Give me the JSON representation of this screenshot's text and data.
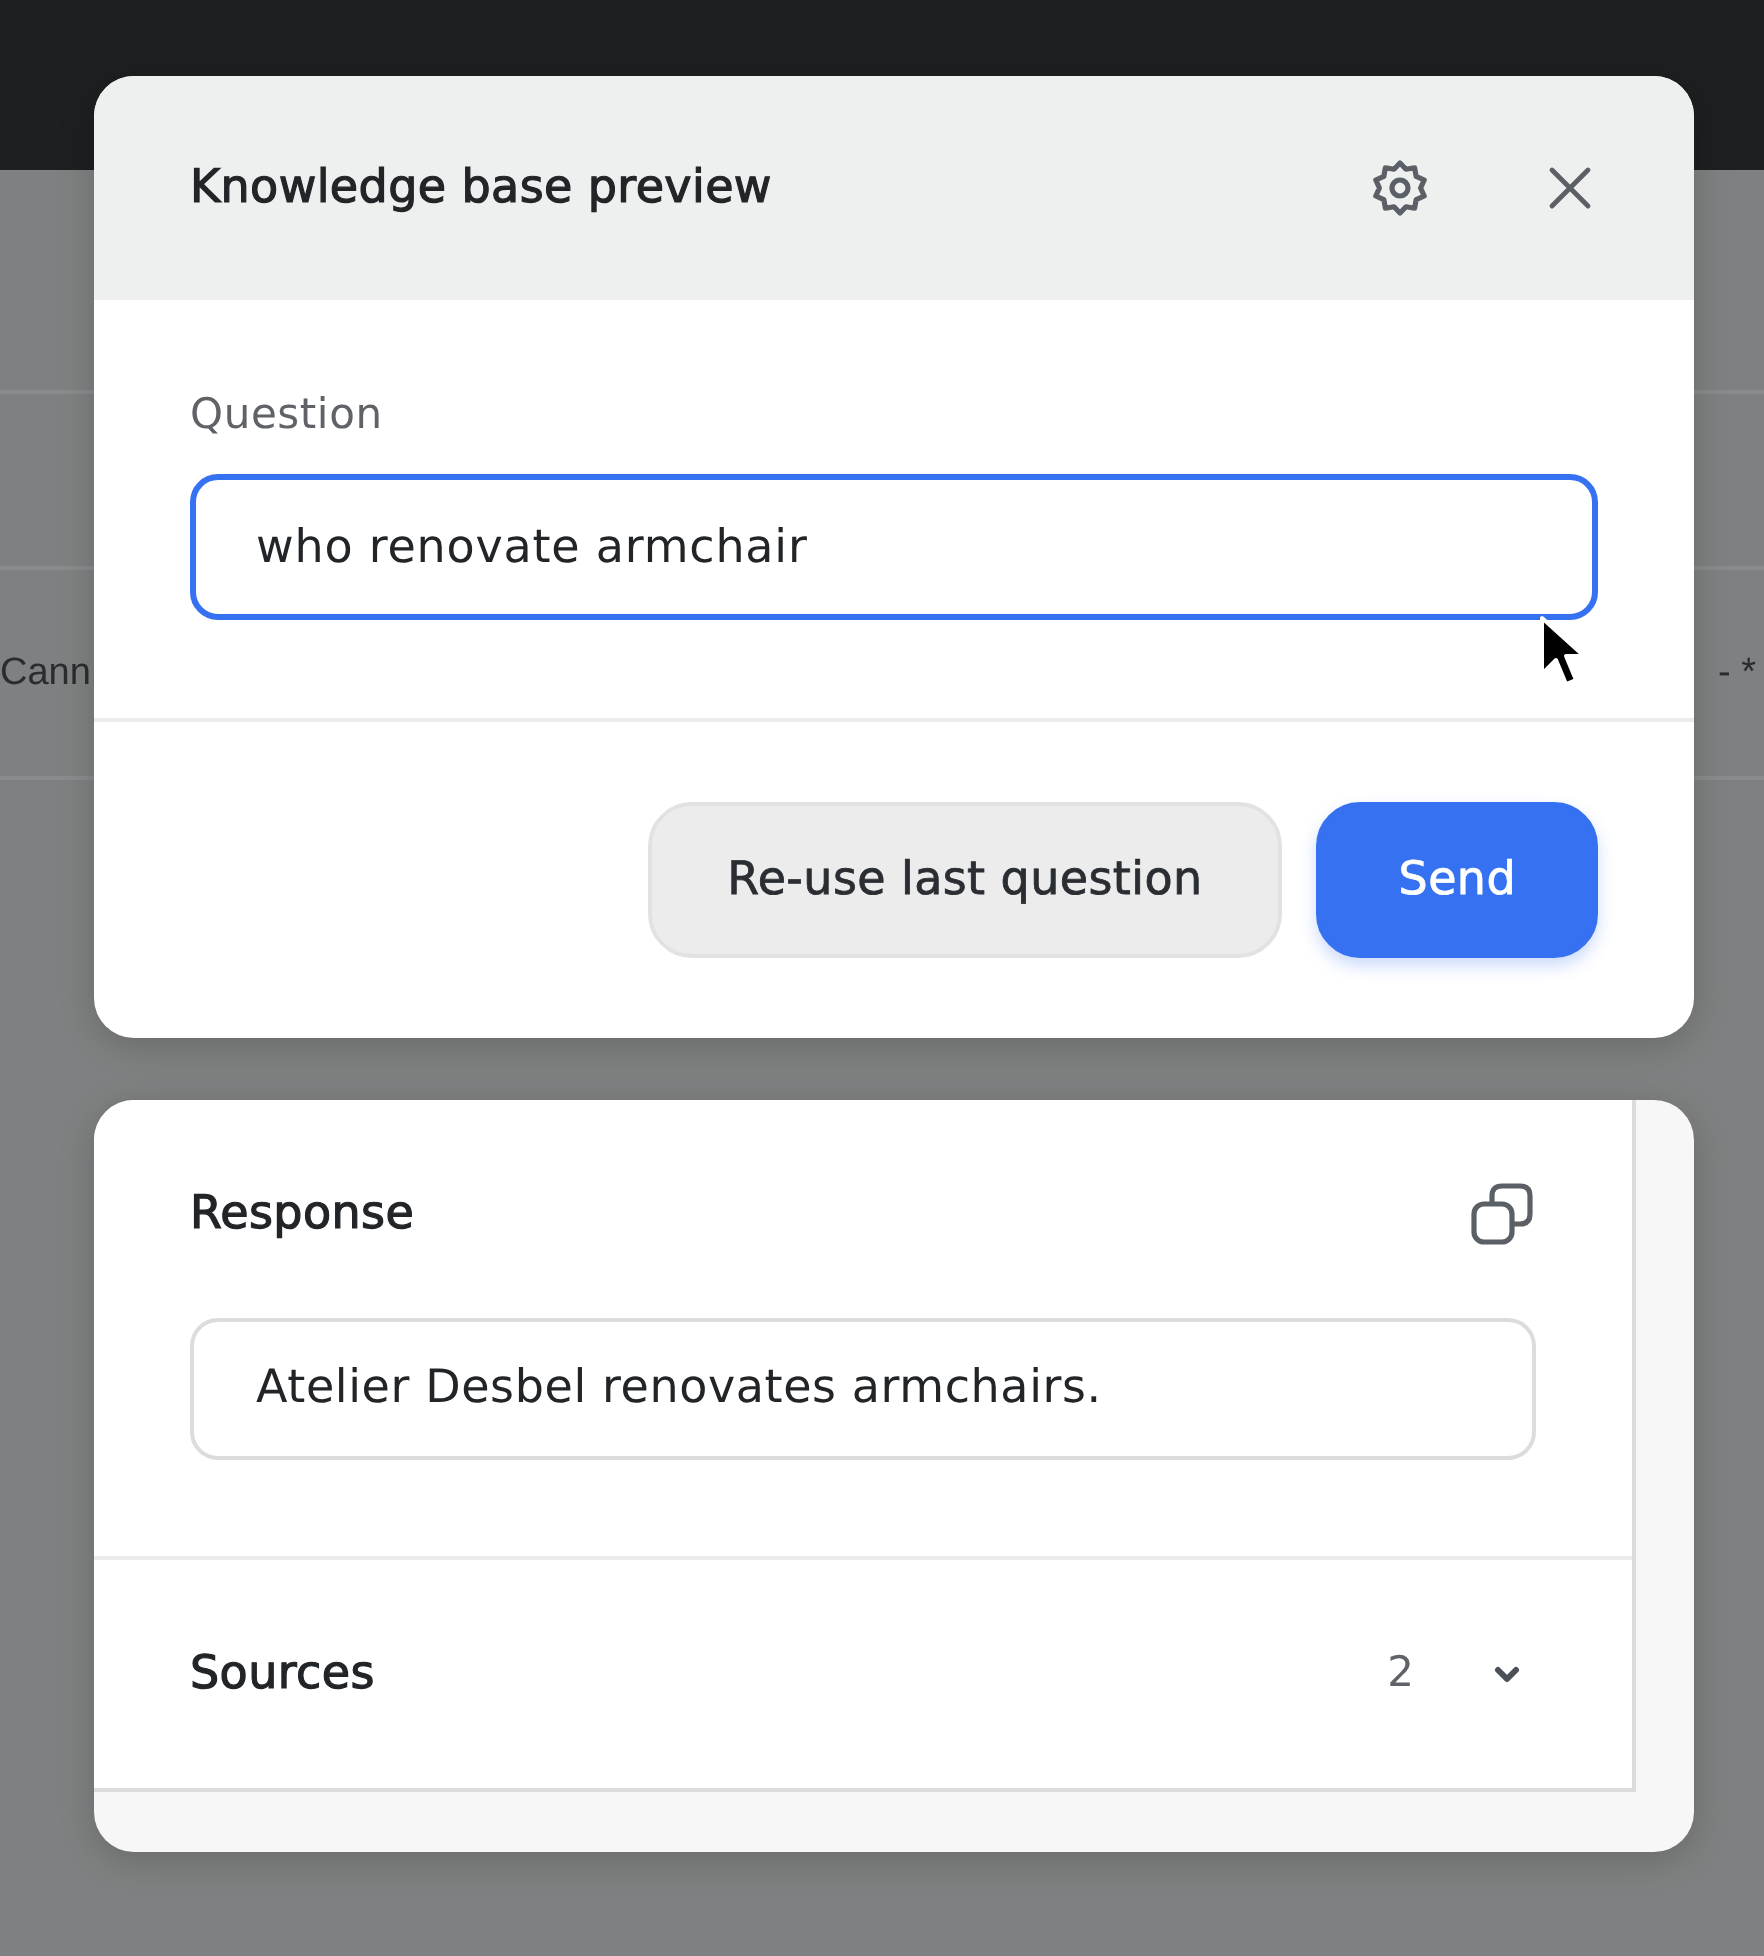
{
  "background": {
    "row_texts": [
      "Cann",
      "- *"
    ]
  },
  "dialog": {
    "title": "Knowledge base preview",
    "question": {
      "label": "Question",
      "value": "who renovate armchair",
      "focused": true
    },
    "buttons": [
      {
        "label": "Re-use last question",
        "kind": "secondary"
      },
      {
        "label": "Send",
        "kind": "primary"
      }
    ]
  },
  "response": {
    "title": "Response",
    "text": "Atelier Desbel renovates armchairs.",
    "sources": {
      "label": "Sources",
      "count": "2",
      "expanded": false
    }
  }
}
